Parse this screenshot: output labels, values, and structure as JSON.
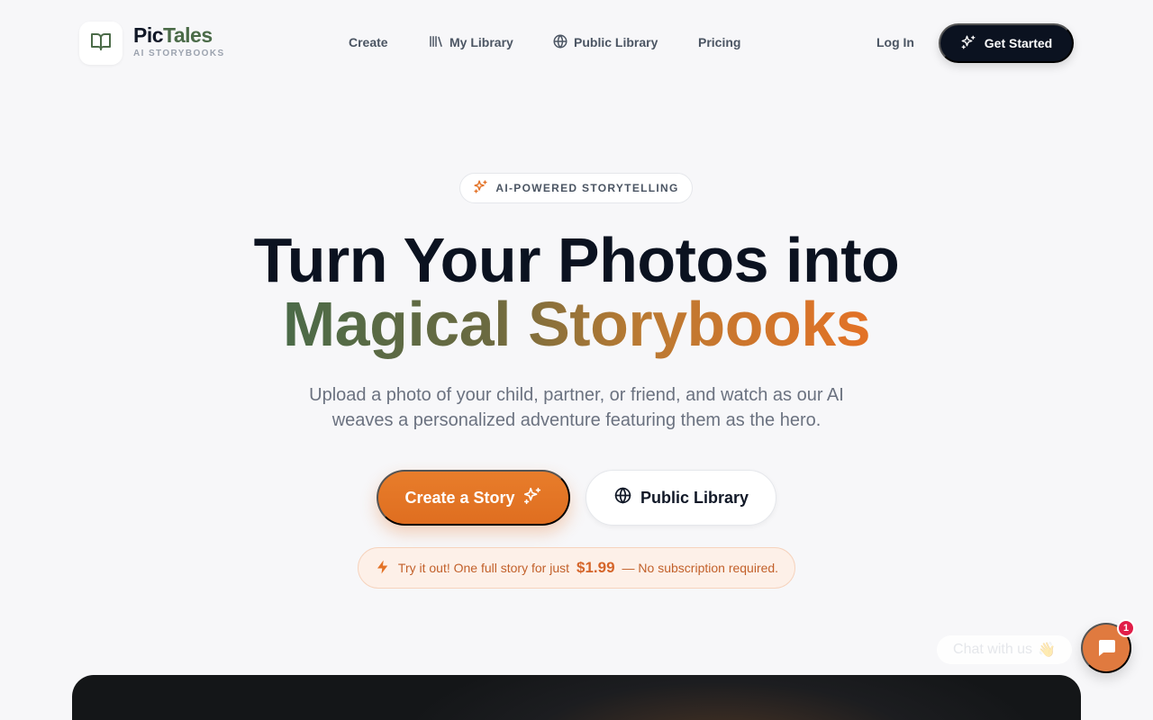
{
  "brand": {
    "name_part1": "Pic",
    "name_part2": "Tales",
    "tagline": "AI STORYBOOKS",
    "logo_icon": "open-book-icon",
    "accent_color": "#4b6b48"
  },
  "nav": {
    "items": [
      {
        "label": "Create",
        "icon": null
      },
      {
        "label": "My Library",
        "icon": "library-icon"
      },
      {
        "label": "Public Library",
        "icon": "globe-icon"
      },
      {
        "label": "Pricing",
        "icon": null
      }
    ],
    "login_label": "Log In",
    "get_started_label": "Get Started",
    "get_started_icon": "sparkles-icon"
  },
  "hero": {
    "badge_label": "AI-POWERED STORYTELLING",
    "badge_icon": "sparkles-icon",
    "headline_line1": "Turn Your Photos into",
    "headline_line2": "Magical Storybooks",
    "subtext": "Upload a photo of your child, partner, or friend, and watch as our AI weaves a personalized adventure featuring them as the hero.",
    "primary_cta": "Create a Story",
    "secondary_cta": "Public Library",
    "promo": {
      "icon": "lightning-icon",
      "prefix": "Try it out! One full story for just",
      "price": "$1.99",
      "suffix": "— No subscription required."
    }
  },
  "chat": {
    "label": "Chat with us",
    "emoji": "👋",
    "unread_count": "1",
    "icon": "chat-bubble-icon"
  },
  "colors": {
    "primary_orange": "#e37226",
    "dark": "#0b1220",
    "green": "#4b6b48",
    "notification_red": "#e11d48"
  }
}
